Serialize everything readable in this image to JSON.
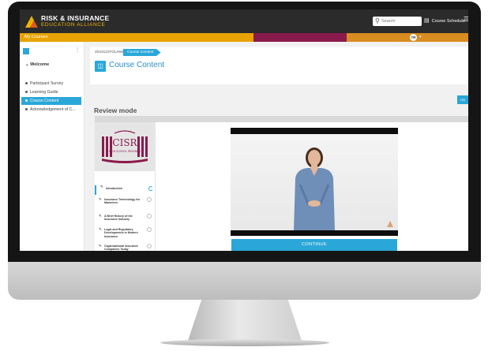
{
  "header": {
    "brand_line1": "RISK & INSURANCE",
    "brand_line2": "EDUCATION ALLIANCE",
    "search_placeholder": "Search",
    "schedule_label": "Course Schedule"
  },
  "strip": {
    "my_courses": "My Courses",
    "avatar_initials": "TR",
    "colors": [
      "#e8a300",
      "#8a1a4c",
      "#d98c1f"
    ]
  },
  "sidebar": {
    "section": "Welcome",
    "items": [
      {
        "label": "Participant Survey"
      },
      {
        "label": "Learning Guide"
      },
      {
        "label": "Course Content"
      },
      {
        "label": "Acknowledgement of C..."
      }
    ]
  },
  "course": {
    "breadcrumb": "2023123TOUHM",
    "breadcrumb_current": "Course Content",
    "title": "Course Content",
    "side_tab": "ON"
  },
  "review": {
    "label": "Review mode"
  },
  "lessons": [
    {
      "title": "Introduction"
    },
    {
      "title": "Insurance Terminology for Marketers"
    },
    {
      "title": "A Brief History of the Insurance Industry"
    },
    {
      "title": "Legal and Regulatory Developments in Modern Insurance"
    },
    {
      "title": "Organizational Insurance Companies Today"
    }
  ],
  "player": {
    "continue_label": "CONTINUE"
  },
  "logo": {
    "brand": "CISR",
    "sub": "HIGH SCHOOL PROGRAM"
  },
  "colors": {
    "accent": "#2aa7d8",
    "topbar": "#2b2b2b",
    "title": "#2a8fc4"
  }
}
